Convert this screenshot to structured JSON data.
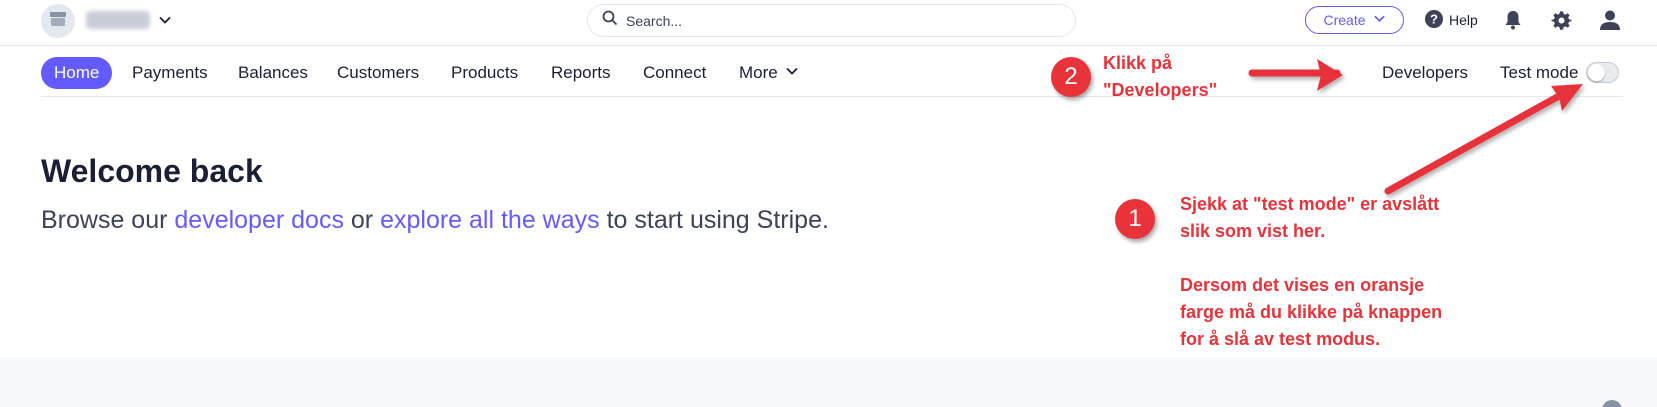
{
  "topbar": {
    "account_name": "redacted",
    "search_placeholder": "Search...",
    "create_label": "Create",
    "help_label": "Help"
  },
  "nav": {
    "items": [
      "Home",
      "Payments",
      "Balances",
      "Customers",
      "Products",
      "Reports",
      "Connect",
      "More"
    ],
    "developers_label": "Developers",
    "test_mode_label": "Test mode",
    "test_mode_on": false
  },
  "main": {
    "title": "Welcome back",
    "subtitle_prefix": "Browse our ",
    "link_docs": "developer docs",
    "subtitle_mid": " or ",
    "link_explore": "explore all the ways",
    "subtitle_suffix": " to start using Stripe."
  },
  "annotations": {
    "step2_number": "2",
    "step2_line1": "Klikk på",
    "step2_line2": "\"Developers\"",
    "step1_number": "1",
    "step1_line1": "Sjekk at \"test mode\" er avslått",
    "step1_line2": "slik som vist her.",
    "step1_line3": "Dersom det vises en oransje",
    "step1_line4": "farge må du klikke på knappen",
    "step1_line5": "for å slå av test modus."
  },
  "colors": {
    "accent": "#635bff",
    "annotation": "#e8333a"
  }
}
